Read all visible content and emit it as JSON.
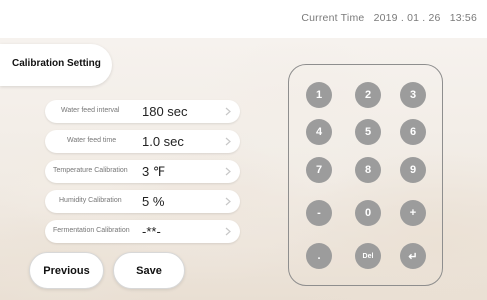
{
  "header": {
    "time_label": "Current Time",
    "date": "2019 . 01 . 26",
    "time": "13:56"
  },
  "page": {
    "title": "Calibration Setting"
  },
  "settings": [
    {
      "label": "Water feed interval",
      "value": "180 sec"
    },
    {
      "label": "Water feed time",
      "value": "1.0 sec"
    },
    {
      "label": "Temperature Calibration",
      "value": "3 ℉"
    },
    {
      "label": "Humidity Calibration",
      "value": "5 %"
    },
    {
      "label": "Fermentation Calibration",
      "value": "-**-"
    }
  ],
  "keypad": {
    "keys": [
      "1",
      "2",
      "3",
      "4",
      "5",
      "6",
      "7",
      "8",
      "9",
      "-",
      "0",
      "+",
      ".",
      "Del",
      "↵"
    ]
  },
  "buttons": {
    "previous": "Previous",
    "save": "Save"
  },
  "colors": {
    "key_fill": "#9c9c9c",
    "keypad_border": "#8e8e8e",
    "card_bg": "#ffffff"
  }
}
